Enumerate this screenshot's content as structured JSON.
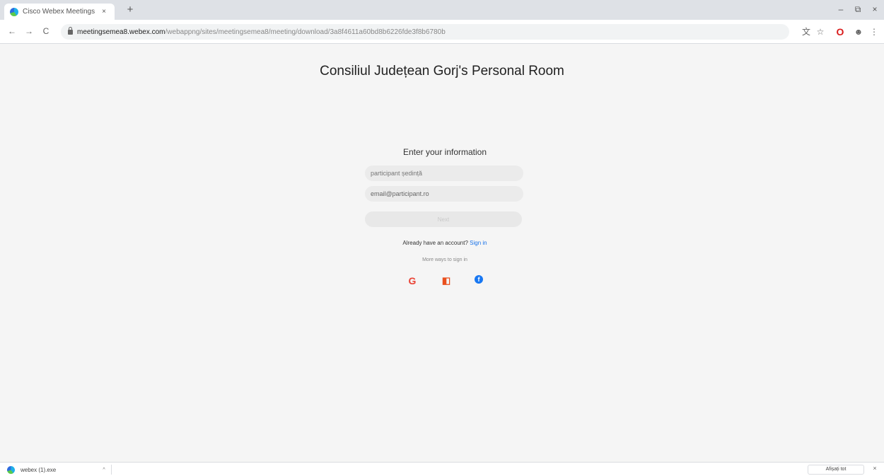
{
  "browser": {
    "tab_title": "Cisco Webex Meetings",
    "tab_close": "×",
    "new_tab": "+",
    "minimize": "–",
    "restore": "⧉",
    "close": "×",
    "nav_back": "←",
    "nav_forward": "→",
    "nav_reload": "C",
    "url_host": "meetingsemea8.webex.com",
    "url_path": "/webappng/sites/meetingsemea8/meeting/download/3a8f4611a60bd8b6226fde3f8b6780b",
    "icons": [
      "translate-icon",
      "star-icon",
      "opera-icon",
      "profile-icon",
      "menu-icon"
    ]
  },
  "page": {
    "room_title": "Consiliul Județean Gorj's Personal Room",
    "form_heading": "Enter your information",
    "name_placeholder": "participant ședință",
    "email_value": "email@participant.ro",
    "next_label": "Next",
    "account_prompt": "Already have an account?",
    "sign_in_link": "Sign in",
    "more_ways": "More ways to sign in"
  },
  "shelf": {
    "download_name": "webex (1).exe",
    "download_arrow": "^",
    "show_all": "Afișați tot",
    "close": "×"
  },
  "colors": {
    "accent": "#1a73e8",
    "google": "#ea4335",
    "office": "#e94f1d",
    "facebook": "#1877f2"
  }
}
